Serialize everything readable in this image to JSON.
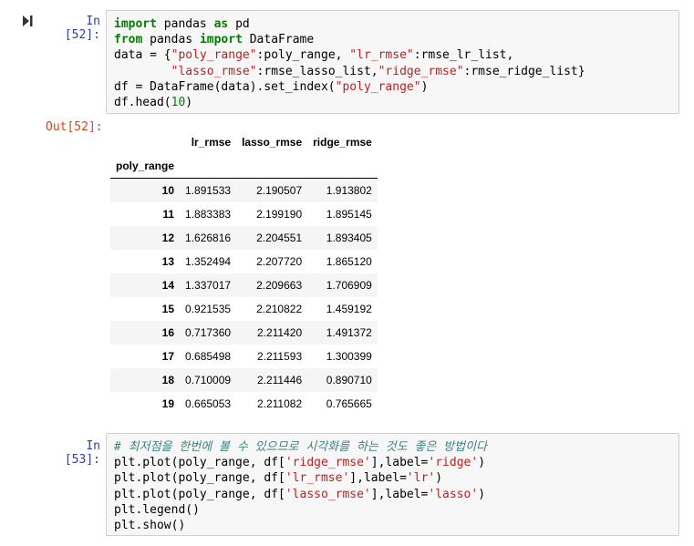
{
  "cell52": {
    "in_prompt": "In [52]:",
    "out_prompt": "Out[52]:",
    "code_lines": [
      [
        [
          "kw",
          "import"
        ],
        [
          "t",
          " pandas "
        ],
        [
          "kw",
          "as"
        ],
        [
          "t",
          " pd"
        ]
      ],
      [
        [
          "kw",
          "from"
        ],
        [
          "t",
          " pandas "
        ],
        [
          "kw",
          "import"
        ],
        [
          "t",
          " DataFrame"
        ]
      ],
      [
        [
          "t",
          "data = {"
        ],
        [
          "str",
          "\"poly_range\""
        ],
        [
          "t",
          ":poly_range, "
        ],
        [
          "str",
          "\"lr_rmse\""
        ],
        [
          "t",
          ":rmse_lr_list,"
        ]
      ],
      [
        [
          "t",
          "        "
        ],
        [
          "str",
          "\"lasso_rmse\""
        ],
        [
          "t",
          ":rmse_lasso_list,"
        ],
        [
          "str",
          "\"ridge_rmse\""
        ],
        [
          "t",
          ":rmse_ridge_list}"
        ]
      ],
      [
        [
          "t",
          "df = DataFrame(data).set_index("
        ],
        [
          "str",
          "\"poly_range\""
        ],
        [
          "t",
          ")"
        ]
      ],
      [
        [
          "t",
          "df.head("
        ],
        [
          "num",
          "10"
        ],
        [
          "t",
          ")"
        ]
      ]
    ]
  },
  "dataframe": {
    "columns": [
      "lr_rmse",
      "lasso_rmse",
      "ridge_rmse"
    ],
    "index_name": "poly_range",
    "rows": [
      {
        "index": "10",
        "values": [
          "1.891533",
          "2.190507",
          "1.913802"
        ]
      },
      {
        "index": "11",
        "values": [
          "1.883383",
          "2.199190",
          "1.895145"
        ]
      },
      {
        "index": "12",
        "values": [
          "1.626816",
          "2.204551",
          "1.893405"
        ]
      },
      {
        "index": "13",
        "values": [
          "1.352494",
          "2.207720",
          "1.865120"
        ]
      },
      {
        "index": "14",
        "values": [
          "1.337017",
          "2.209663",
          "1.706909"
        ]
      },
      {
        "index": "15",
        "values": [
          "0.921535",
          "2.210822",
          "1.459192"
        ]
      },
      {
        "index": "16",
        "values": [
          "0.717360",
          "2.211420",
          "1.491372"
        ]
      },
      {
        "index": "17",
        "values": [
          "0.685498",
          "2.211593",
          "1.300399"
        ]
      },
      {
        "index": "18",
        "values": [
          "0.710009",
          "2.211446",
          "0.890710"
        ]
      },
      {
        "index": "19",
        "values": [
          "0.665053",
          "2.211082",
          "0.765665"
        ]
      }
    ]
  },
  "cell53": {
    "in_prompt": "In [53]:",
    "code_lines": [
      [
        [
          "cmt",
          "# 최저점을 한번에 볼 수 있으므로 시각화를 하는 것도 좋은 방법이다"
        ]
      ],
      [
        [
          "t",
          "plt.plot(poly_range, df["
        ],
        [
          "str",
          "'ridge_rmse'"
        ],
        [
          "t",
          "],label="
        ],
        [
          "str",
          "'ridge'"
        ],
        [
          "t",
          ")"
        ]
      ],
      [
        [
          "t",
          "plt.plot(poly_range, df["
        ],
        [
          "str",
          "'lr_rmse'"
        ],
        [
          "t",
          "],label="
        ],
        [
          "str",
          "'lr'"
        ],
        [
          "t",
          ")"
        ]
      ],
      [
        [
          "t",
          "plt.plot(poly_range, df["
        ],
        [
          "str",
          "'lasso_rmse'"
        ],
        [
          "t",
          "],label="
        ],
        [
          "str",
          "'lasso'"
        ],
        [
          "t",
          ")"
        ]
      ],
      [
        [
          "t",
          "plt.legend()"
        ]
      ],
      [
        [
          "t",
          "plt.show()"
        ]
      ]
    ]
  },
  "icons": {
    "run": "step-forward-icon"
  },
  "colors": {
    "in_prompt": "#303f9f",
    "out_prompt": "#d84315",
    "keyword": "#008000",
    "string": "#ba2121",
    "comment": "#408080",
    "cell_bg": "#f7f7f7"
  }
}
